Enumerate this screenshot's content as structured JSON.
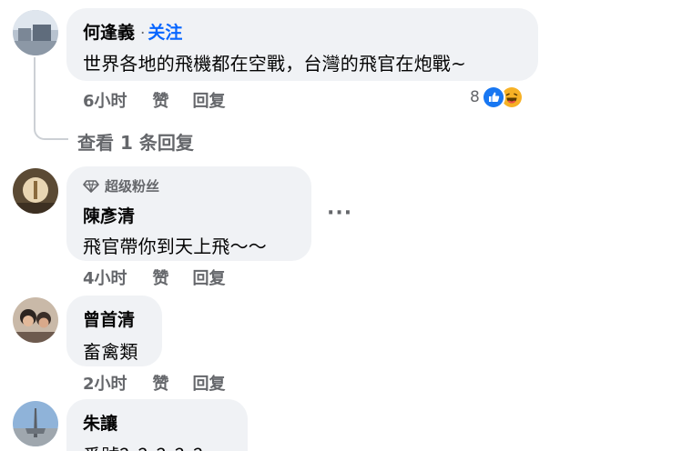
{
  "comments": [
    {
      "author": "何逢義",
      "follow_separator": "·",
      "follow_label": "关注",
      "text": "世界各地的飛機都在空戰，台灣的飛官在炮戰~",
      "time": "6小时",
      "like_label": "赞",
      "reply_label": "回复",
      "reaction_count": "8",
      "reaction_icons": [
        "like-icon",
        "haha-icon"
      ],
      "view_replies": "查看 1 条回复"
    },
    {
      "badge": "超级粉丝",
      "badge_icon": "diamond-icon",
      "author": "陳彥清",
      "text": "飛官帶你到天上飛～～",
      "more_label": "···",
      "time": "4小时",
      "like_label": "赞",
      "reply_label": "回复"
    },
    {
      "author": "曾首清",
      "text": "畜禽類",
      "time": "2小时",
      "like_label": "赞",
      "reply_label": "回复"
    },
    {
      "author": "朱讓",
      "text": "番號？？？？？"
    }
  ],
  "colors": {
    "bubble": "#f0f2f5",
    "secondary_text": "#65676b",
    "follow_link": "#0866ff",
    "like_blue": "#1877f2",
    "haha_yellow": "#f7b125"
  }
}
